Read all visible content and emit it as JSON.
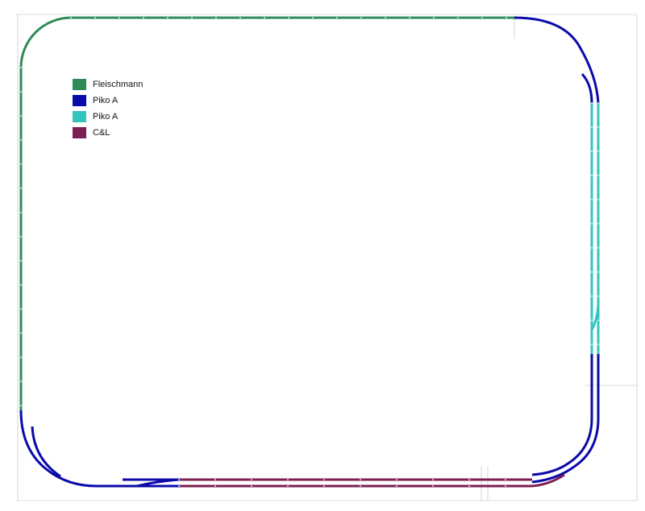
{
  "legend": [
    {
      "label": "Fleischmann",
      "color": "#2e8b57"
    },
    {
      "label": "Piko A",
      "color": "#0a0aaa"
    },
    {
      "label": "Piko A",
      "color": "#33c4c0"
    },
    {
      "label": "C&L",
      "color": "#7b1f50"
    }
  ],
  "colors": {
    "fleischmann": "#2e8b57",
    "piko_a_dark": "#0a0aaa",
    "piko_a_light": "#33c4c0",
    "cl": "#7b1f50",
    "dimension_line": "#bbbbbb",
    "joint": "#ffffff"
  }
}
